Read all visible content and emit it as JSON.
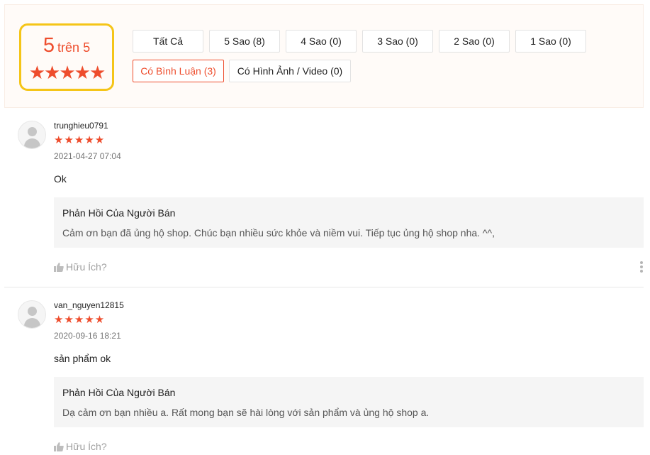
{
  "rating_summary": {
    "score": "5",
    "out_of": "trên 5",
    "stars": "★★★★★"
  },
  "filters": [
    {
      "label": "Tất Cả",
      "active": false
    },
    {
      "label": "5 Sao (8)",
      "active": false
    },
    {
      "label": "4 Sao (0)",
      "active": false
    },
    {
      "label": "3 Sao (0)",
      "active": false
    },
    {
      "label": "2 Sao (0)",
      "active": false
    },
    {
      "label": "1 Sao (0)",
      "active": false
    },
    {
      "label": "Có Bình Luận (3)",
      "active": true
    },
    {
      "label": "Có Hình Ảnh / Video (0)",
      "active": false
    }
  ],
  "reviews": [
    {
      "username": "trunghieu0791",
      "stars": "★★★★★",
      "rating": 5,
      "date": "2021-04-27 07:04",
      "comment": "Ok",
      "reply_title": "Phản Hồi Của Người Bán",
      "reply_text": "Cảm ơn bạn đã ủng hộ shop. Chúc bạn nhiều sức khỏe và niềm vui. Tiếp tục ủng hộ shop nha. ^^,",
      "helpful_label": "Hữu Ích?"
    },
    {
      "username": "van_nguyen12815",
      "stars": "★★★★★",
      "rating": 5,
      "date": "2020-09-16 18:21",
      "comment": "sản phẩm ok",
      "reply_title": "Phản Hồi Của Người Bán",
      "reply_text": "Dạ cảm ơn bạn nhiều a. Rất mong bạn sẽ hài lòng với sản phẩm và ủng hộ shop a.",
      "helpful_label": "Hữu Ích?"
    }
  ],
  "colors": {
    "accent": "#ee4d2d",
    "highlight_border": "#f5c518",
    "summary_bg": "#fffbf8",
    "reply_bg": "#f5f5f5"
  }
}
